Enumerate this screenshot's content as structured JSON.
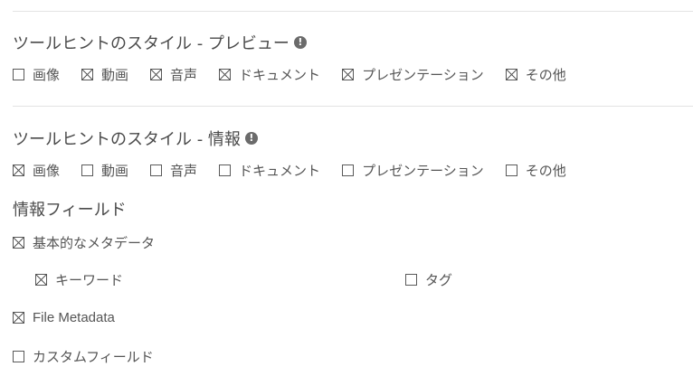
{
  "preview_section": {
    "title": "ツールヒントのスタイル - プレビュー",
    "info": "!",
    "options": [
      {
        "label": "画像",
        "checked": false
      },
      {
        "label": "動画",
        "checked": true
      },
      {
        "label": "音声",
        "checked": true
      },
      {
        "label": "ドキュメント",
        "checked": true
      },
      {
        "label": "プレゼンテーション",
        "checked": true
      },
      {
        "label": "その他",
        "checked": true
      }
    ]
  },
  "info_section": {
    "title": "ツールヒントのスタイル - 情報",
    "info": "!",
    "options": [
      {
        "label": "画像",
        "checked": true
      },
      {
        "label": "動画",
        "checked": false
      },
      {
        "label": "音声",
        "checked": false
      },
      {
        "label": "ドキュメント",
        "checked": false
      },
      {
        "label": "プレゼンテーション",
        "checked": false
      },
      {
        "label": "その他",
        "checked": false
      }
    ]
  },
  "info_fields": {
    "heading": "情報フィールド",
    "basic_metadata": {
      "label": "基本的なメタデータ",
      "checked": true
    },
    "keywords": {
      "label": "キーワード",
      "checked": true
    },
    "tags": {
      "label": "タグ",
      "checked": false
    },
    "file_metadata": {
      "label": "File Metadata",
      "checked": true
    },
    "custom_fields": {
      "label": "カスタムフィールド",
      "checked": false
    }
  }
}
